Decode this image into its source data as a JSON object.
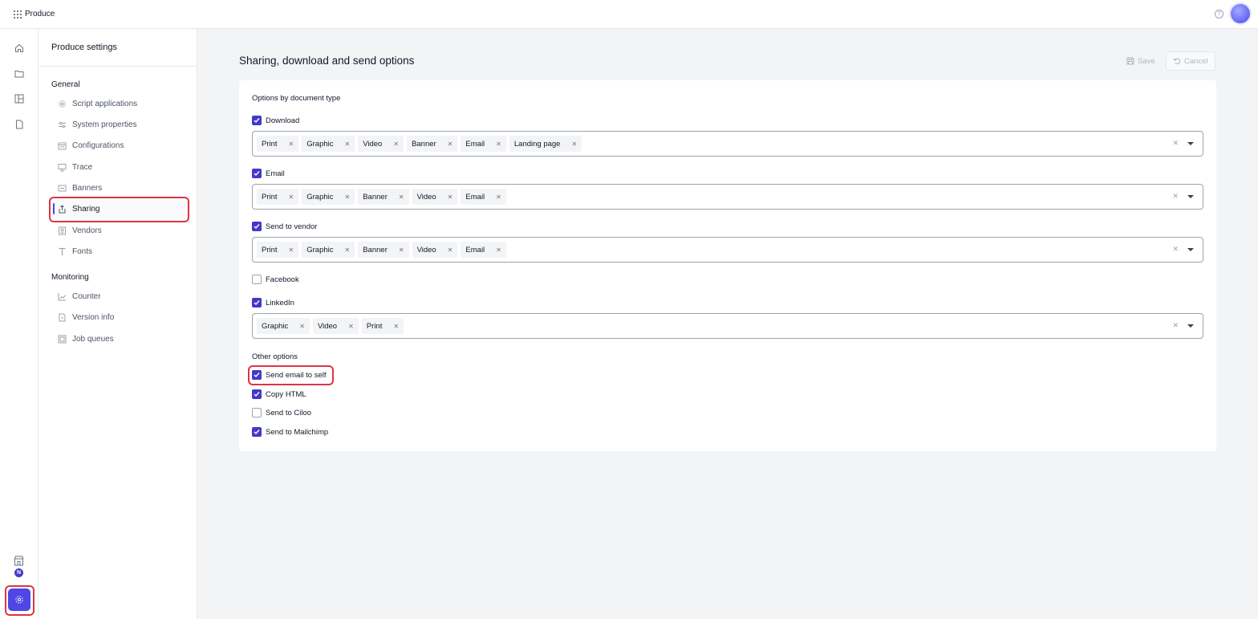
{
  "app": {
    "name": "Produce"
  },
  "settings_nav": {
    "title": "Produce settings",
    "groups": [
      {
        "label": "General",
        "items": [
          {
            "label": "Script applications",
            "icon": "gear-icon"
          },
          {
            "label": "System properties",
            "icon": "sliders-icon"
          },
          {
            "label": "Configurations",
            "icon": "config-icon"
          },
          {
            "label": "Trace",
            "icon": "monitor-icon"
          },
          {
            "label": "Banners",
            "icon": "banner-icon"
          },
          {
            "label": "Sharing",
            "icon": "share-icon",
            "active": true
          },
          {
            "label": "Vendors",
            "icon": "vendor-icon"
          },
          {
            "label": "Fonts",
            "icon": "font-icon"
          }
        ]
      },
      {
        "label": "Monitoring",
        "items": [
          {
            "label": "Counter",
            "icon": "chart-line-icon"
          },
          {
            "label": "Version info",
            "icon": "document-icon"
          },
          {
            "label": "Job queues",
            "icon": "queue-icon"
          }
        ]
      }
    ]
  },
  "rail": {
    "badge": "N"
  },
  "main": {
    "title": "Sharing, download and send options",
    "save_label": "Save",
    "cancel_label": "Cancel",
    "options_label": "Options by document type",
    "doc_options": [
      {
        "label": "Download",
        "checked": true,
        "tags": [
          "Print",
          "Graphic",
          "Video",
          "Banner",
          "Email",
          "Landing page"
        ]
      },
      {
        "label": "Email",
        "checked": true,
        "tags": [
          "Print",
          "Graphic",
          "Banner",
          "Video",
          "Email"
        ]
      },
      {
        "label": "Send to vendor",
        "checked": true,
        "tags": [
          "Print",
          "Graphic",
          "Banner",
          "Video",
          "Email"
        ]
      },
      {
        "label": "Facebook",
        "checked": false,
        "tags": null
      },
      {
        "label": "LinkedIn",
        "checked": true,
        "tags": [
          "Graphic",
          "Video",
          "Print"
        ]
      }
    ],
    "other_label": "Other options",
    "other_options": [
      {
        "label": "Send email to self",
        "checked": true
      },
      {
        "label": "Copy HTML",
        "checked": true
      },
      {
        "label": "Send to Ciloo",
        "checked": false
      },
      {
        "label": "Send to Mailchimp",
        "checked": true
      }
    ]
  },
  "colors": {
    "accent": "#4338ca",
    "highlight": "#dc3545"
  }
}
